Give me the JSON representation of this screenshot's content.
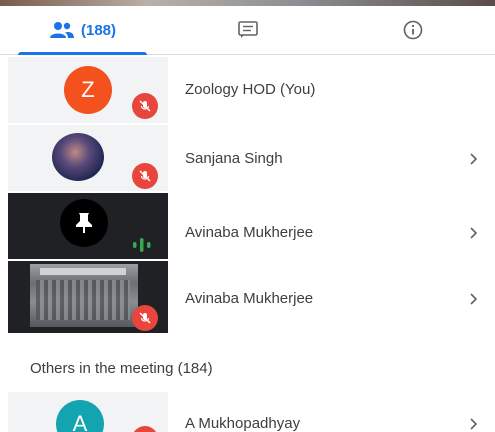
{
  "tabs": [
    {
      "icon": "people-icon",
      "label": "(188)",
      "active": true
    },
    {
      "icon": "chat-icon",
      "label": "",
      "active": false
    },
    {
      "icon": "info-icon",
      "label": "",
      "active": false
    }
  ],
  "participants": [
    {
      "name": "Zoology HOD (You)",
      "avatar_letter": "Z",
      "avatar_color": "#f4511e",
      "muted": true
    },
    {
      "name": "Sanjana Singh",
      "muted": true
    },
    {
      "name": "Avinaba Mukherjee",
      "speaking": true
    },
    {
      "name": "Avinaba Mukherjee",
      "muted": true
    }
  ],
  "others": {
    "title": "Others in the meeting (184)",
    "items": [
      {
        "name": "A Mukhopadhyay",
        "avatar_letter": "A",
        "avatar_color": "#12a4af"
      }
    ]
  },
  "colors": {
    "accent": "#1a73e8",
    "muted_red": "#e8453c",
    "speaking_green": "#34a853"
  }
}
